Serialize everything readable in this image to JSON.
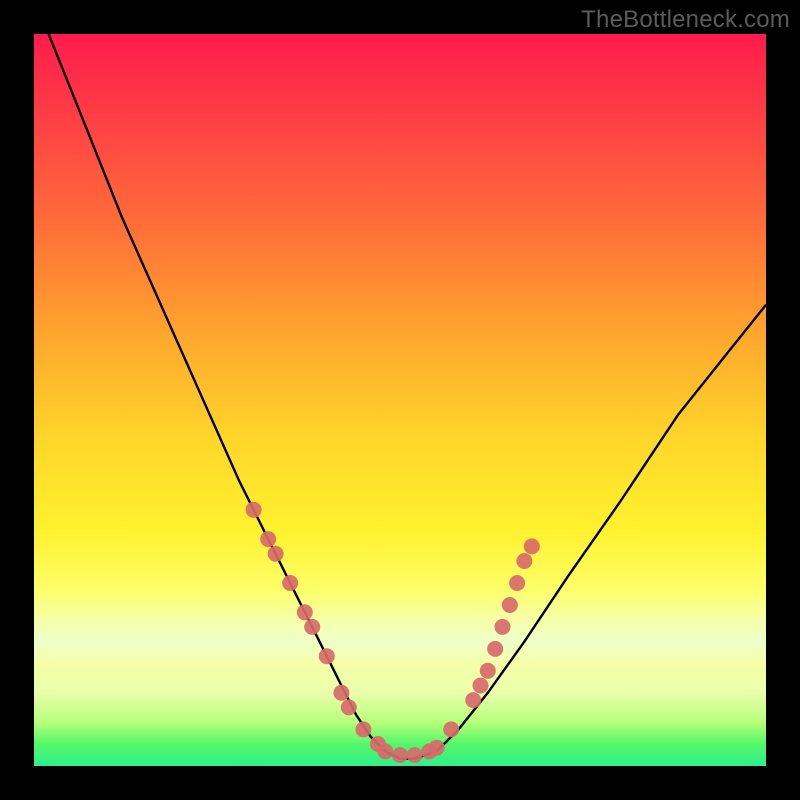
{
  "watermark": "TheBottleneck.com",
  "chart_data": {
    "type": "line",
    "title": "",
    "xlabel": "",
    "ylabel": "",
    "xlim": [
      0,
      100
    ],
    "ylim": [
      0,
      100
    ],
    "grid": false,
    "legend": false,
    "curve": {
      "name": "bottleneck-curve",
      "x": [
        2,
        4,
        8,
        12,
        16,
        20,
        24,
        28,
        30,
        32,
        34,
        36,
        38,
        40,
        42,
        44,
        46,
        48,
        50,
        52,
        55,
        58,
        62,
        67,
        73,
        80,
        88,
        96,
        100
      ],
      "y": [
        100,
        95,
        85,
        75,
        66,
        57,
        48,
        39,
        35,
        31,
        27,
        23,
        19,
        15,
        11,
        7,
        4,
        2,
        1,
        1,
        2,
        5,
        10,
        17,
        26,
        36,
        48,
        58,
        63
      ]
    },
    "markers": {
      "name": "curve-sample-markers",
      "color": "#d86a6a",
      "radius": 8,
      "points": [
        {
          "x": 30,
          "y": 35
        },
        {
          "x": 32,
          "y": 31
        },
        {
          "x": 33,
          "y": 29
        },
        {
          "x": 35,
          "y": 25
        },
        {
          "x": 37,
          "y": 21
        },
        {
          "x": 38,
          "y": 19
        },
        {
          "x": 40,
          "y": 15
        },
        {
          "x": 42,
          "y": 10
        },
        {
          "x": 43,
          "y": 8
        },
        {
          "x": 45,
          "y": 5
        },
        {
          "x": 47,
          "y": 3
        },
        {
          "x": 48,
          "y": 2
        },
        {
          "x": 50,
          "y": 1.5
        },
        {
          "x": 52,
          "y": 1.5
        },
        {
          "x": 54,
          "y": 2
        },
        {
          "x": 55,
          "y": 2.5
        },
        {
          "x": 57,
          "y": 5
        },
        {
          "x": 60,
          "y": 9
        },
        {
          "x": 61,
          "y": 11
        },
        {
          "x": 62,
          "y": 13
        },
        {
          "x": 63,
          "y": 16
        },
        {
          "x": 64,
          "y": 19
        },
        {
          "x": 65,
          "y": 22
        },
        {
          "x": 66,
          "y": 25
        },
        {
          "x": 67,
          "y": 28
        },
        {
          "x": 68,
          "y": 30
        }
      ]
    },
    "gradient_stops": [
      {
        "pos": 0.0,
        "color": "#ff1c4c"
      },
      {
        "pos": 0.25,
        "color": "#ff6a3a"
      },
      {
        "pos": 0.55,
        "color": "#ffd52a"
      },
      {
        "pos": 0.8,
        "color": "#f5ffa8"
      },
      {
        "pos": 0.97,
        "color": "#55f76a"
      },
      {
        "pos": 1.0,
        "color": "#2df08a"
      }
    ]
  }
}
